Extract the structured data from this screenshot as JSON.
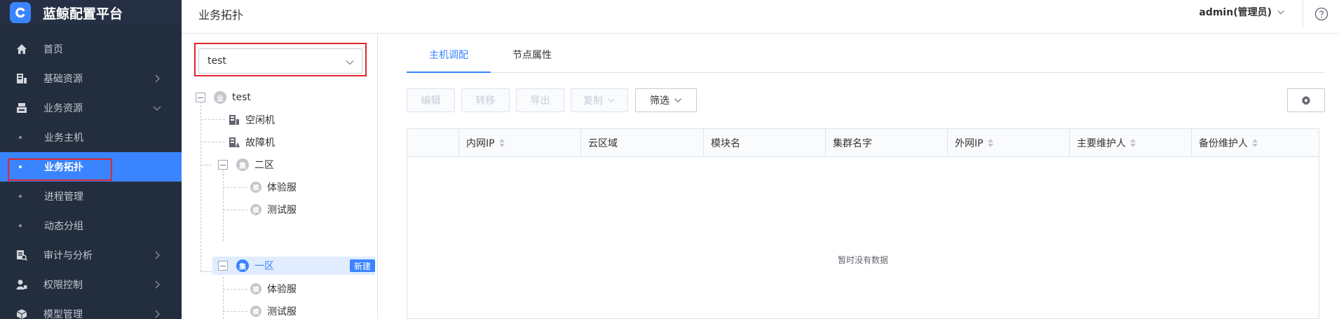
{
  "app": {
    "title": "蓝鲸配置平台"
  },
  "sidebar": {
    "items": [
      {
        "label": "首页",
        "icon": "home-icon"
      },
      {
        "label": "基础资源",
        "icon": "resource-icon"
      },
      {
        "label": "业务资源",
        "icon": "business-icon"
      },
      {
        "label": "审计与分析",
        "icon": "audit-icon"
      },
      {
        "label": "权限控制",
        "icon": "permission-icon"
      },
      {
        "label": "模型管理",
        "icon": "model-icon"
      }
    ],
    "business_submenu": [
      "业务主机",
      "业务拓扑",
      "进程管理",
      "动态分组"
    ],
    "active": "业务拓扑"
  },
  "header": {
    "title": "业务拓扑",
    "user": "admin(管理员)",
    "help_icon": "help-icon"
  },
  "topology": {
    "selected_business": "test",
    "tree": {
      "root": {
        "label": "test",
        "badge": "业"
      },
      "idle_pool": "空闲机",
      "fault_pool": "故障机",
      "set_badge": "集",
      "module_badge": "模",
      "sets": [
        {
          "label": "二区",
          "modules": [
            "体验服",
            "测试服"
          ]
        },
        {
          "label": "一区",
          "modules": [
            "体验服",
            "测试服"
          ],
          "action": "新建"
        }
      ]
    }
  },
  "tabs": {
    "host": "主机调配",
    "props": "节点属性"
  },
  "toolbar": {
    "edit": "编辑",
    "transfer": "转移",
    "export": "导出",
    "copy": "复制",
    "filter": "筛选"
  },
  "table": {
    "columns": [
      "内网IP",
      "云区域",
      "模块名",
      "集群名字",
      "外网IP",
      "主要维护人",
      "备份维护人"
    ],
    "empty": "暂时没有数据"
  },
  "colors": {
    "accent": "#3a84ff",
    "sidebar_bg": "#222d3d",
    "highlight_border": "#e0262c"
  }
}
